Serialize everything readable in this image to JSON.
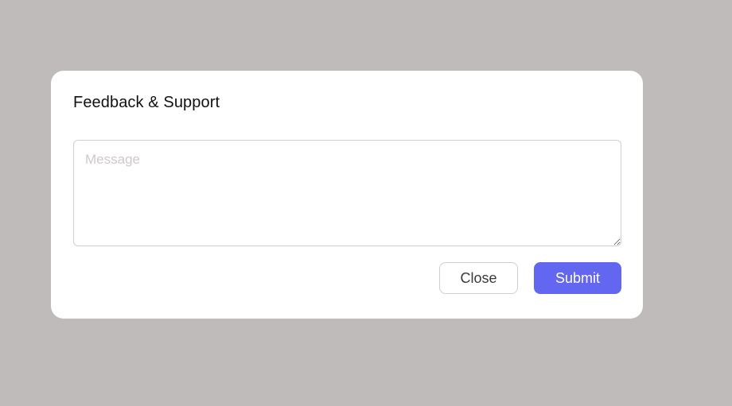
{
  "dialog": {
    "title": "Feedback & Support",
    "message": {
      "placeholder": "Message",
      "value": ""
    },
    "buttons": {
      "close_label": "Close",
      "submit_label": "Submit"
    }
  },
  "colors": {
    "backdrop": "#bfbbba",
    "panel": "#ffffff",
    "accent": "#6366f1",
    "border": "#cfcfcf",
    "placeholder": "#cfc9c9"
  }
}
